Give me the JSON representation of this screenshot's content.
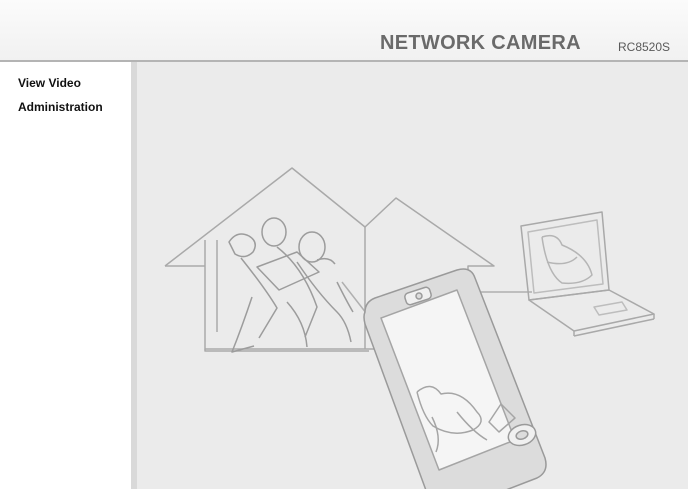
{
  "header": {
    "brand": "NETWORK CAMERA",
    "model": "RC8520S"
  },
  "sidebar": {
    "items": [
      {
        "label": "View Video"
      },
      {
        "label": "Administration"
      }
    ]
  },
  "colors": {
    "background": "#ebebeb",
    "header_border": "#b4b4b4",
    "line_art": "#a9a9a9"
  }
}
